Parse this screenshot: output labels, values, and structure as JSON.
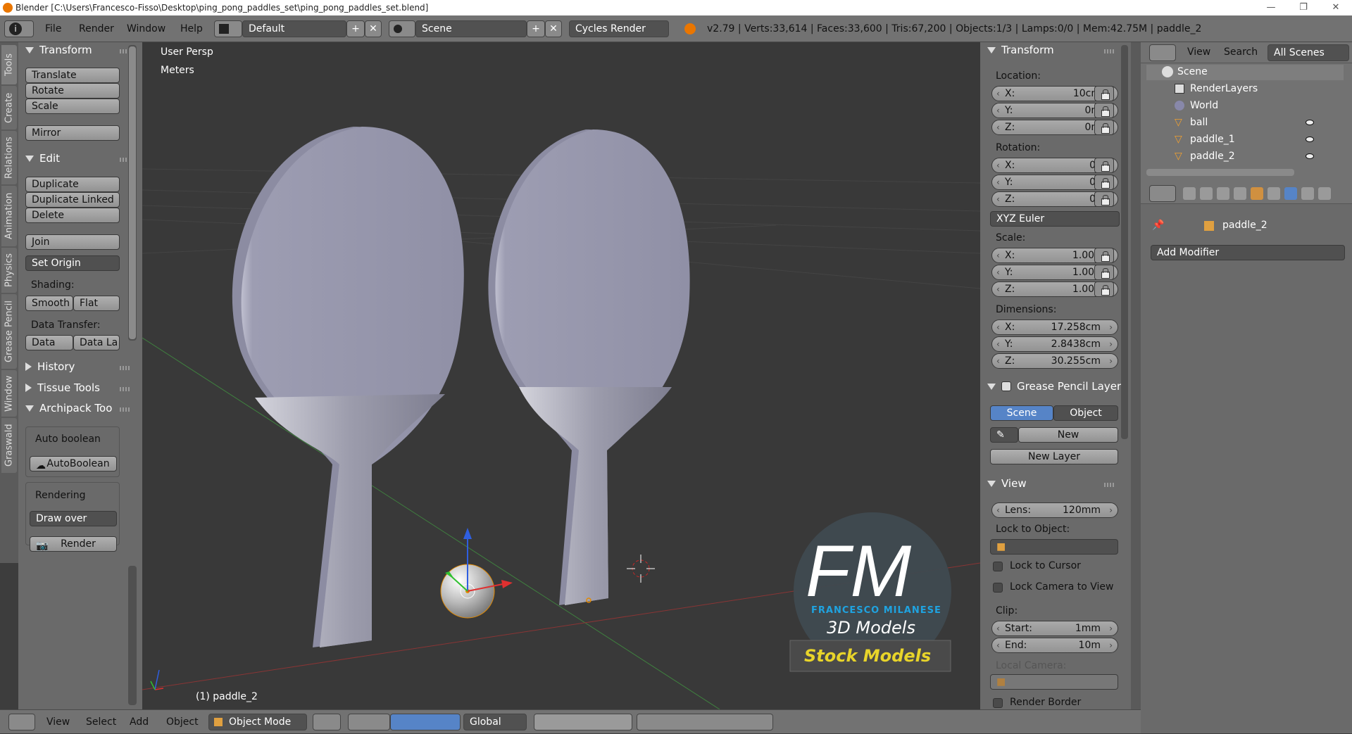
{
  "window": {
    "title": "Blender [C:\\Users\\Francesco-Fisso\\Desktop\\ping_pong_paddles_set\\ping_pong_paddles_set.blend]"
  },
  "menu": {
    "file": "File",
    "render": "Render",
    "window": "Window",
    "help": "Help"
  },
  "screen_layout": "Default",
  "scene_name": "Scene",
  "render_engine": "Cycles Render",
  "stats": "v2.79 | Verts:33,614 | Faces:33,600 | Tris:67,200 | Objects:1/3 | Lamps:0/0 | Mem:42.75M | paddle_2",
  "left_tabs": [
    "Tools",
    "Create",
    "Relations",
    "Animation",
    "Physics",
    "Grease Pencil",
    "Window",
    "Graswald"
  ],
  "toolshelf": {
    "transform_header": "Transform",
    "translate": "Translate",
    "rotate": "Rotate",
    "scale": "Scale",
    "mirror": "Mirror",
    "edit_header": "Edit",
    "duplicate": "Duplicate",
    "duplicate_linked": "Duplicate Linked",
    "delete": "Delete",
    "join": "Join",
    "set_origin": "Set Origin",
    "shading_label": "Shading:",
    "smooth": "Smooth",
    "flat": "Flat",
    "data_transfer_label": "Data Transfer:",
    "data": "Data",
    "data_la": "Data La",
    "history_header": "History",
    "tissue_header": "Tissue Tools",
    "archipack_header": "Archipack Too",
    "auto_boolean_label": "Auto boolean",
    "autoboolean_btn": "AutoBoolean",
    "rendering_label": "Rendering",
    "draw_over": "Draw over",
    "render_btn": "Render"
  },
  "viewport": {
    "view_name": "User Persp",
    "units": "Meters",
    "object_label": "(1) paddle_2",
    "watermark": {
      "initials": "FM",
      "name": "FRANCESCO MILANESE",
      "tagline": "3D Models",
      "banner": "Stock Models"
    }
  },
  "properties": {
    "transform_header": "Transform",
    "location_label": "Location:",
    "loc_x": "10cm",
    "loc_y": "0m",
    "loc_z": "0m",
    "rotation_label": "Rotation:",
    "rot_x": "0°",
    "rot_y": "0°",
    "rot_z": "0°",
    "rotation_mode": "XYZ Euler",
    "scale_label": "Scale:",
    "scale_x": "1.000",
    "scale_y": "1.000",
    "scale_z": "1.000",
    "dimensions_label": "Dimensions:",
    "dim_x": "17.258cm",
    "dim_y": "2.8438cm",
    "dim_z": "30.255cm",
    "gp_header": "Grease Pencil Layer",
    "gp_scene": "Scene",
    "gp_object": "Object",
    "gp_new": "New",
    "gp_new_layer": "New Layer",
    "view_header": "View",
    "lens_label": "Lens:",
    "lens_value": "120mm",
    "lock_to_object": "Lock to Object:",
    "lock_to_cursor": "Lock to Cursor",
    "lock_camera": "Lock Camera to View",
    "clip_label": "Clip:",
    "clip_start_label": "Start:",
    "clip_start": "1mm",
    "clip_end_label": "End:",
    "clip_end": "10m",
    "local_camera": "Local Camera:",
    "render_border": "Render Border",
    "axis_x": "X:",
    "axis_y": "Y:",
    "axis_z": "Z:"
  },
  "outliner": {
    "view": "View",
    "search": "Search",
    "filter": "All Scenes",
    "items": [
      "Scene",
      "RenderLayers",
      "World",
      "ball",
      "paddle_1",
      "paddle_2"
    ]
  },
  "property_editor": {
    "object_name": "paddle_2",
    "add_modifier": "Add Modifier"
  },
  "bottombar": {
    "view": "View",
    "select": "Select",
    "add": "Add",
    "object": "Object",
    "mode": "Object Mode",
    "orientation": "Global"
  },
  "colors": {
    "accent_blue": "#5684c7",
    "paddle": "#9595ab",
    "watermark_blue": "#1fa3e0",
    "watermark_yellow": "#e8d42a"
  }
}
